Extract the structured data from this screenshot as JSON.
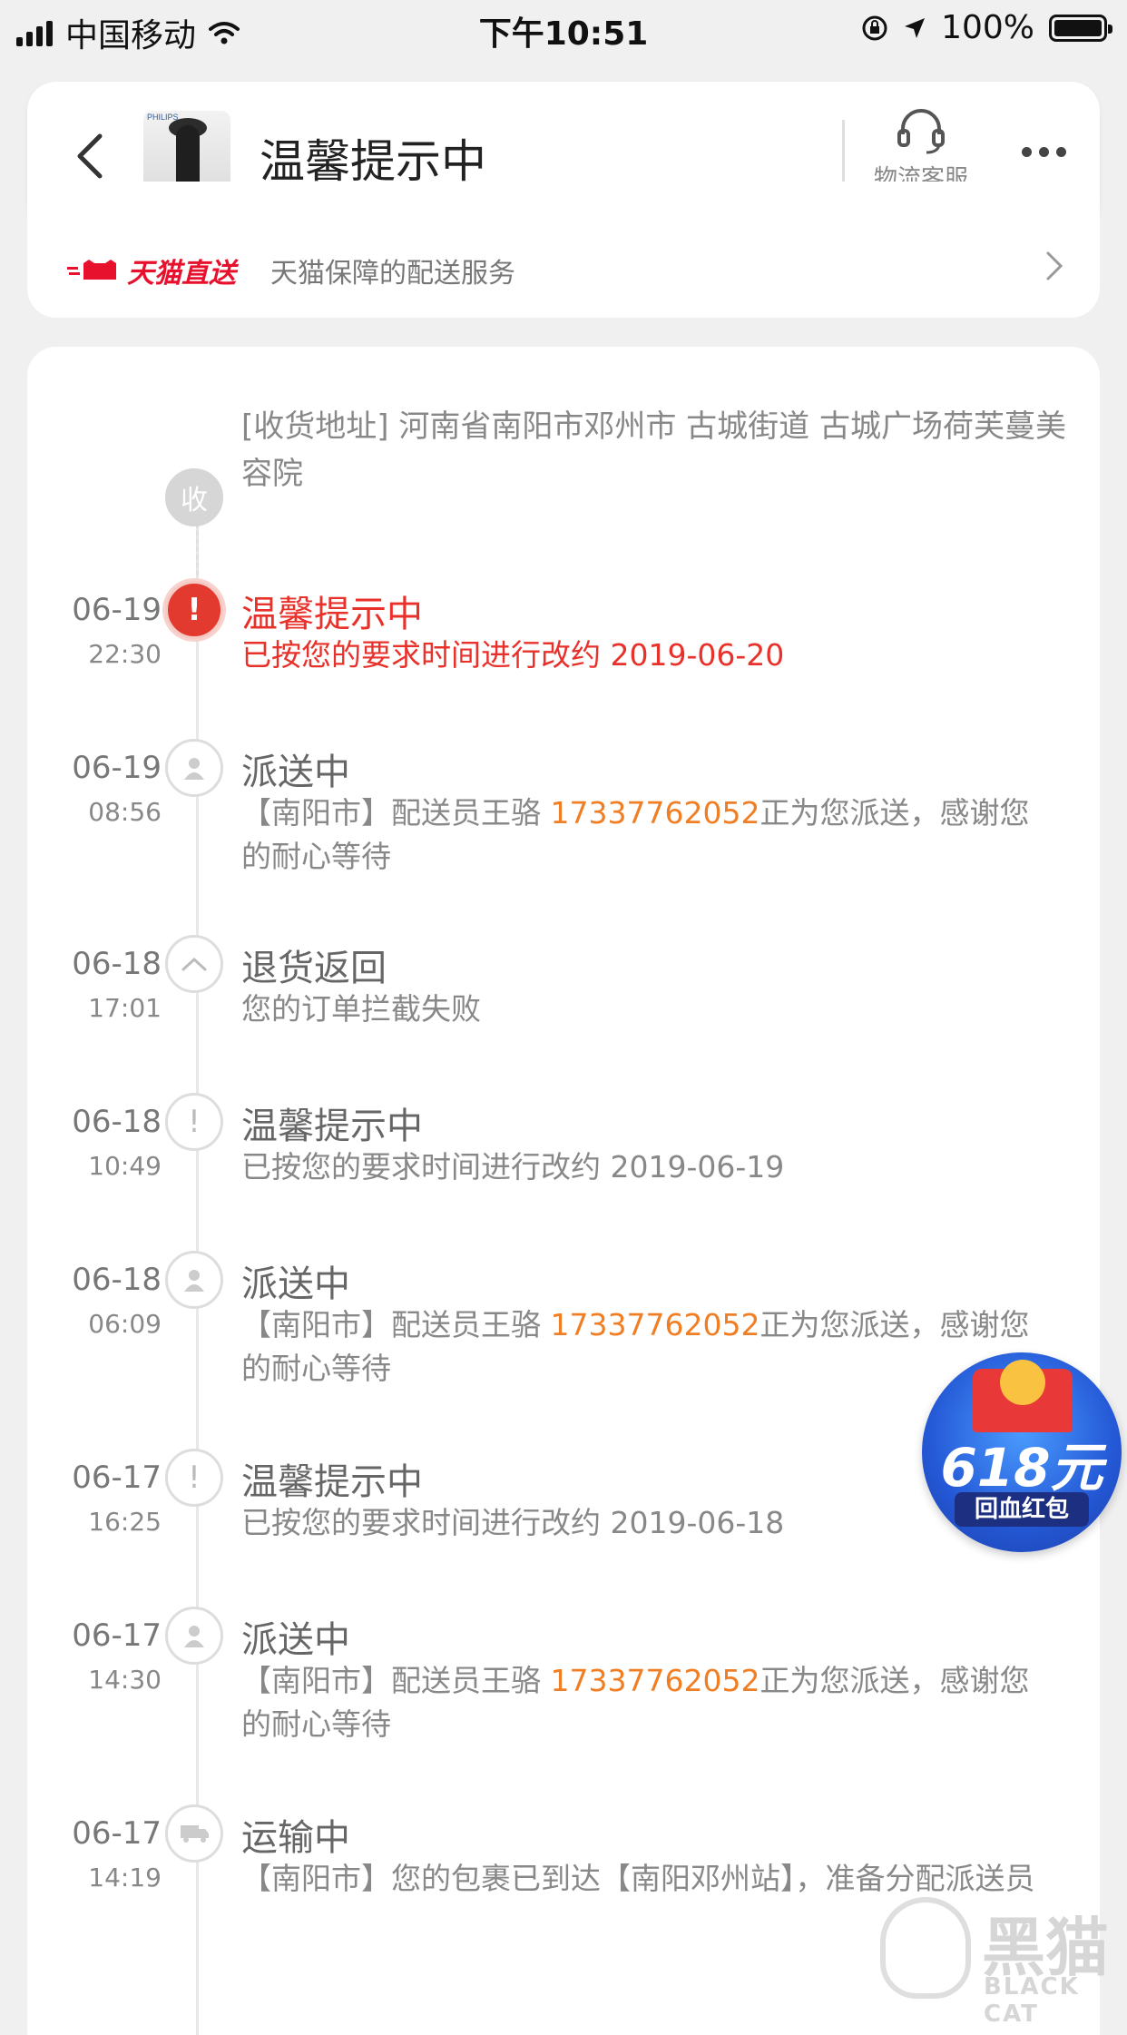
{
  "status_bar": {
    "carrier": "中国移动",
    "time": "下午10:51",
    "battery": "100%",
    "battery_level": 1.0
  },
  "header": {
    "title": "温馨提示中",
    "product_brand": "PHILIPS",
    "service_label": "物流客服"
  },
  "delivery": {
    "brand": "天猫直送",
    "description": "天猫保障的配送服务"
  },
  "address": {
    "node_label": "收",
    "text": "[收货地址] 河南省南阳市邓州市  古城街道   古城广场荷芙蔓美容院"
  },
  "events": [
    {
      "date": "06-19",
      "time": "22:30",
      "icon": "alert-icon",
      "status": "温馨提示中",
      "detail_pre": "已按您的要求时间进行改约 2019-06-20",
      "phone": "",
      "detail_post": ""
    },
    {
      "date": "06-19",
      "time": "08:56",
      "icon": "person-icon",
      "status": "派送中",
      "detail_pre": "【南阳市】配送员王骆 ",
      "phone": "17337762052",
      "detail_post": "正为您派送，感谢您的耐心等待"
    },
    {
      "date": "06-18",
      "time": "17:01",
      "icon": "chevron-up-icon",
      "status": "退货返回",
      "detail_pre": "您的订单拦截失败",
      "phone": "",
      "detail_post": ""
    },
    {
      "date": "06-18",
      "time": "10:49",
      "icon": "alert-icon",
      "status": "温馨提示中",
      "detail_pre": "已按您的要求时间进行改约 2019-06-19",
      "phone": "",
      "detail_post": ""
    },
    {
      "date": "06-18",
      "time": "06:09",
      "icon": "person-icon",
      "status": "派送中",
      "detail_pre": "【南阳市】配送员王骆 ",
      "phone": "17337762052",
      "detail_post": "正为您派送，感谢您的耐心等待"
    },
    {
      "date": "06-17",
      "time": "16:25",
      "icon": "alert-icon",
      "status": "温馨提示中",
      "detail_pre": "已按您的要求时间进行改约 2019-06-18",
      "phone": "",
      "detail_post": ""
    },
    {
      "date": "06-17",
      "time": "14:30",
      "icon": "person-icon",
      "status": "派送中",
      "detail_pre": "【南阳市】配送员王骆 ",
      "phone": "17337762052",
      "detail_post": "正为您派送，感谢您的耐心等待"
    },
    {
      "date": "06-17",
      "time": "14:19",
      "icon": "truck-icon",
      "status": "运输中",
      "detail_pre": "【南阳市】您的包裹已到达【南阳邓州站】，准备分配派送员",
      "phone": "",
      "detail_post": ""
    }
  ],
  "promo_badge": {
    "amount": "618元",
    "label": "回血红包"
  },
  "watermark": {
    "cn": "黑猫",
    "en": "BLACK CAT"
  },
  "colors": {
    "accent_red": "#e8312a",
    "phone_orange": "#f07e24",
    "tmall_red": "#e8112d"
  }
}
